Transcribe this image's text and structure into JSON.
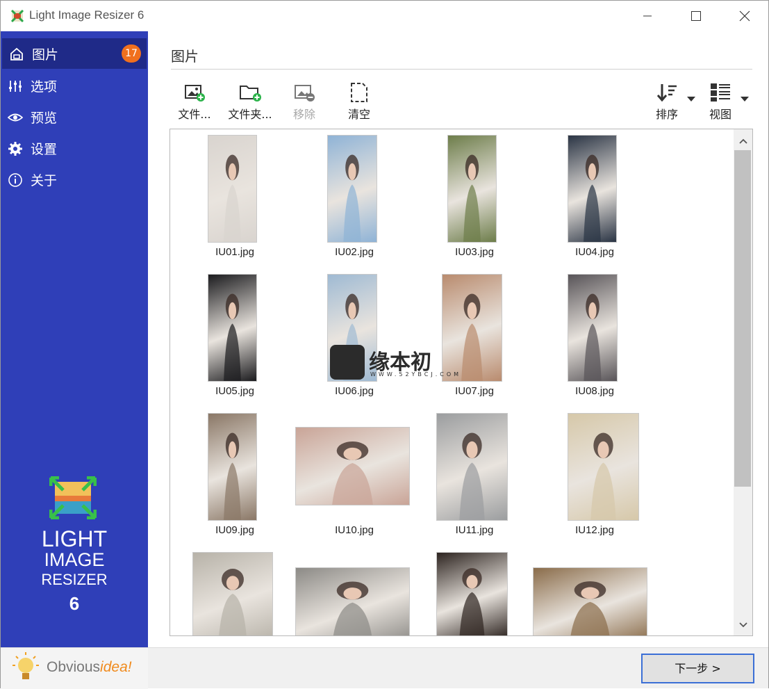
{
  "window": {
    "title": "Light Image Resizer 6"
  },
  "sidebar": {
    "items": [
      {
        "label": "图片",
        "icon": "home-icon",
        "badge": "17",
        "active": true
      },
      {
        "label": "选项",
        "icon": "sliders-icon"
      },
      {
        "label": "预览",
        "icon": "eye-icon"
      },
      {
        "label": "设置",
        "icon": "gear-icon"
      },
      {
        "label": "关于",
        "icon": "info-icon"
      }
    ],
    "logo": {
      "line1": "LIGHT",
      "line2": "IMAGE",
      "line3": "RESIZER",
      "line4": "6"
    },
    "brand": {
      "part1": "Obvious",
      "part2": "idea!"
    }
  },
  "main": {
    "title": "图片",
    "toolbar": {
      "add_files": "文件...",
      "add_folder": "文件夹...",
      "remove": "移除",
      "clear": "清空",
      "sort": "排序",
      "view": "视图"
    },
    "images": [
      {
        "name": "IU01.jpg",
        "color": "#d9d4cf"
      },
      {
        "name": "IU02.jpg",
        "color": "#8fb3d6"
      },
      {
        "name": "IU03.jpg",
        "color": "#6d7d4a"
      },
      {
        "name": "IU04.jpg",
        "color": "#2a3444"
      },
      {
        "name": "IU05.jpg",
        "color": "#1b1b1e"
      },
      {
        "name": "IU06.jpg",
        "color": "#9fbad3"
      },
      {
        "name": "IU07.jpg",
        "color": "#b98b6e"
      },
      {
        "name": "IU08.jpg",
        "color": "#585458"
      },
      {
        "name": "IU09.jpg",
        "color": "#8a7766"
      },
      {
        "name": "IU10.jpg",
        "color": "#c9a497"
      },
      {
        "name": "IU11.jpg",
        "color": "#9b9d9f"
      },
      {
        "name": "IU12.jpg",
        "color": "#d6c8a9"
      },
      {
        "name": "",
        "color": "#b7b2a8"
      },
      {
        "name": "",
        "color": "#8c8a86"
      },
      {
        "name": "",
        "color": "#2d2420"
      },
      {
        "name": "",
        "color": "#8a6c4a"
      }
    ],
    "next_button": "下一步 >"
  },
  "watermark": {
    "text": "缘本初",
    "sub": "WWW.52YBCJ.COM"
  },
  "colors": {
    "sidebar": "#2f3fb8",
    "sidebar_active": "#1f2a88",
    "badge": "#f0701e",
    "accent_focus": "#3b6fd6"
  }
}
